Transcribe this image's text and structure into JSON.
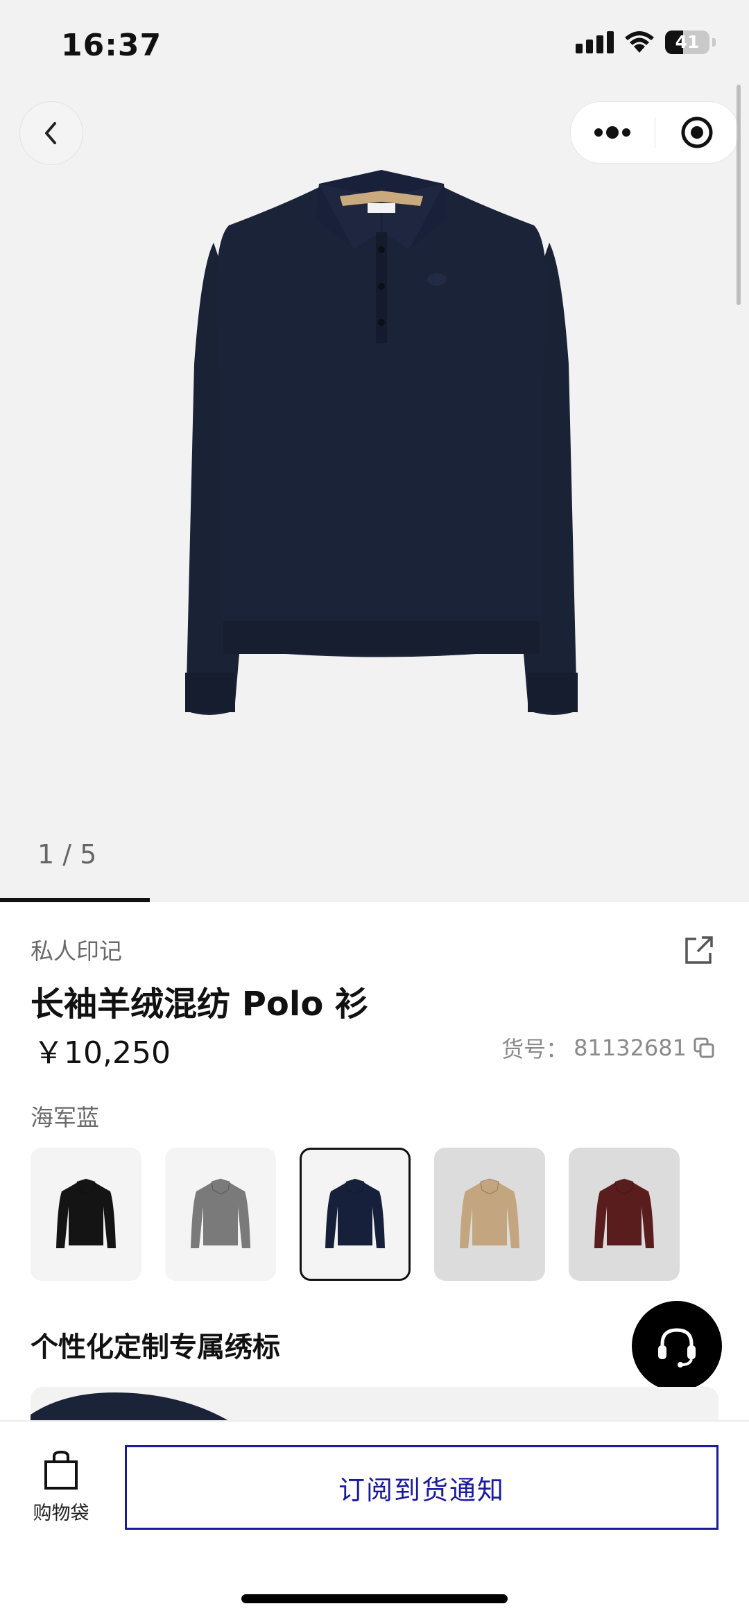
{
  "status_bar": {
    "time": "16:37",
    "battery": "41",
    "battery_level": 0.41
  },
  "gallery": {
    "counter": "1 / 5",
    "current": 1,
    "total": 5,
    "progress": 0.2
  },
  "product": {
    "category": "私人印记",
    "title": "长袖羊绒混纺 Polo 衫",
    "price": "￥10,250",
    "sku_label": "货号：",
    "sku": "81132681",
    "color_name": "海军蓝"
  },
  "swatches": [
    {
      "name": "black",
      "color": "#141414"
    },
    {
      "name": "grey",
      "color": "#7a7a7a"
    },
    {
      "name": "navy",
      "color": "#16203a",
      "selected": true
    },
    {
      "name": "camel",
      "color": "#c3a57f"
    },
    {
      "name": "burgundy",
      "color": "#5a1d1e"
    }
  ],
  "customization": {
    "title": "个性化定制专属绣标"
  },
  "bottom_bar": {
    "bag_label": "购物袋",
    "notify_label": "订阅到货通知"
  },
  "colors": {
    "accent": "#1a1a9c",
    "garment": "#1b2338"
  },
  "icons": {
    "back": "chevron-left-icon",
    "more": "more-dots-icon",
    "close": "target-icon",
    "share": "share-icon",
    "copy": "copy-icon",
    "support": "headset-icon",
    "bag": "bag-icon"
  }
}
